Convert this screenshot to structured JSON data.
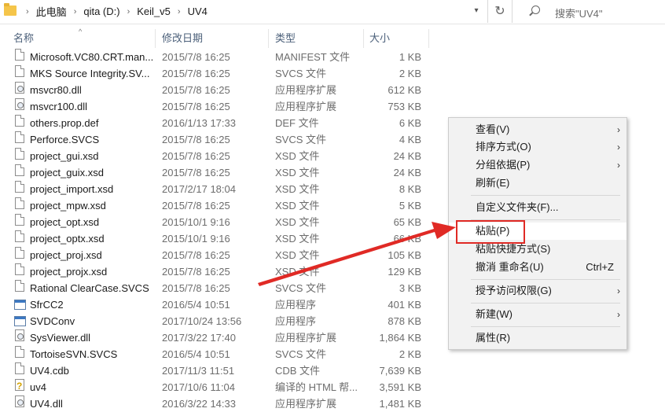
{
  "address": {
    "path": [
      "此电脑",
      "qita (D:)",
      "Keil_v5",
      "UV4"
    ]
  },
  "search": {
    "placeholder": "搜索\"UV4\""
  },
  "columns": {
    "name": "名称",
    "date": "修改日期",
    "type": "类型",
    "size": "大小"
  },
  "files": [
    {
      "name": "Microsoft.VC80.CRT.man...",
      "date": "2015/7/8 16:25",
      "type": "MANIFEST 文件",
      "size": "1 KB",
      "icon": "file-icon"
    },
    {
      "name": "MKS Source Integrity.SV...",
      "date": "2015/7/8 16:25",
      "type": "SVCS 文件",
      "size": "2 KB",
      "icon": "file-icon"
    },
    {
      "name": "msvcr80.dll",
      "date": "2015/7/8 16:25",
      "type": "应用程序扩展",
      "size": "612 KB",
      "icon": "dll-icon"
    },
    {
      "name": "msvcr100.dll",
      "date": "2015/7/8 16:25",
      "type": "应用程序扩展",
      "size": "753 KB",
      "icon": "dll-icon"
    },
    {
      "name": "others.prop.def",
      "date": "2016/1/13 17:33",
      "type": "DEF 文件",
      "size": "6 KB",
      "icon": "file-icon"
    },
    {
      "name": "Perforce.SVCS",
      "date": "2015/7/8 16:25",
      "type": "SVCS 文件",
      "size": "4 KB",
      "icon": "file-icon"
    },
    {
      "name": "project_gui.xsd",
      "date": "2015/7/8 16:25",
      "type": "XSD 文件",
      "size": "24 KB",
      "icon": "file-icon"
    },
    {
      "name": "project_guix.xsd",
      "date": "2015/7/8 16:25",
      "type": "XSD 文件",
      "size": "24 KB",
      "icon": "file-icon"
    },
    {
      "name": "project_import.xsd",
      "date": "2017/2/17 18:04",
      "type": "XSD 文件",
      "size": "8 KB",
      "icon": "file-icon"
    },
    {
      "name": "project_mpw.xsd",
      "date": "2015/7/8 16:25",
      "type": "XSD 文件",
      "size": "5 KB",
      "icon": "file-icon"
    },
    {
      "name": "project_opt.xsd",
      "date": "2015/10/1 9:16",
      "type": "XSD 文件",
      "size": "65 KB",
      "icon": "file-icon"
    },
    {
      "name": "project_optx.xsd",
      "date": "2015/10/1 9:16",
      "type": "XSD 文件",
      "size": "66 KB",
      "icon": "file-icon"
    },
    {
      "name": "project_proj.xsd",
      "date": "2015/7/8 16:25",
      "type": "XSD 文件",
      "size": "105 KB",
      "icon": "file-icon"
    },
    {
      "name": "project_projx.xsd",
      "date": "2015/7/8 16:25",
      "type": "XSD 文件",
      "size": "129 KB",
      "icon": "file-icon"
    },
    {
      "name": "Rational ClearCase.SVCS",
      "date": "2015/7/8 16:25",
      "type": "SVCS 文件",
      "size": "3 KB",
      "icon": "file-icon"
    },
    {
      "name": "SfrCC2",
      "date": "2016/5/4 10:51",
      "type": "应用程序",
      "size": "401 KB",
      "icon": "exe-icon"
    },
    {
      "name": "SVDConv",
      "date": "2017/10/24 13:56",
      "type": "应用程序",
      "size": "878 KB",
      "icon": "exe-icon"
    },
    {
      "name": "SysViewer.dll",
      "date": "2017/3/22 17:40",
      "type": "应用程序扩展",
      "size": "1,864 KB",
      "icon": "dll-icon"
    },
    {
      "name": "TortoiseSVN.SVCS",
      "date": "2016/5/4 10:51",
      "type": "SVCS 文件",
      "size": "2 KB",
      "icon": "file-icon"
    },
    {
      "name": "UV4.cdb",
      "date": "2017/11/3 11:51",
      "type": "CDB 文件",
      "size": "7,639 KB",
      "icon": "file-icon"
    },
    {
      "name": "uv4",
      "date": "2017/10/6 11:04",
      "type": "编译的 HTML 帮...",
      "size": "3,591 KB",
      "icon": "help-icon"
    },
    {
      "name": "UV4.dll",
      "date": "2016/3/22 14:33",
      "type": "应用程序扩展",
      "size": "1,481 KB",
      "icon": "dll-icon"
    }
  ],
  "context_menu": {
    "view": "查看(V)",
    "sort": "排序方式(O)",
    "group": "分组依据(P)",
    "refresh": "刷新(E)",
    "customize": "自定义文件夹(F)...",
    "paste": "粘贴(P)",
    "paste_shortcut": "粘贴快捷方式(S)",
    "undo_rename": "撤消 重命名(U)",
    "undo_shortcut": "Ctrl+Z",
    "grant_access": "授予访问权限(G)",
    "new": "新建(W)",
    "properties": "属性(R)"
  },
  "colors": {
    "highlight_box": "#e02a25",
    "arrow": "#e02a25",
    "menu_bg": "#f2f2f2"
  }
}
